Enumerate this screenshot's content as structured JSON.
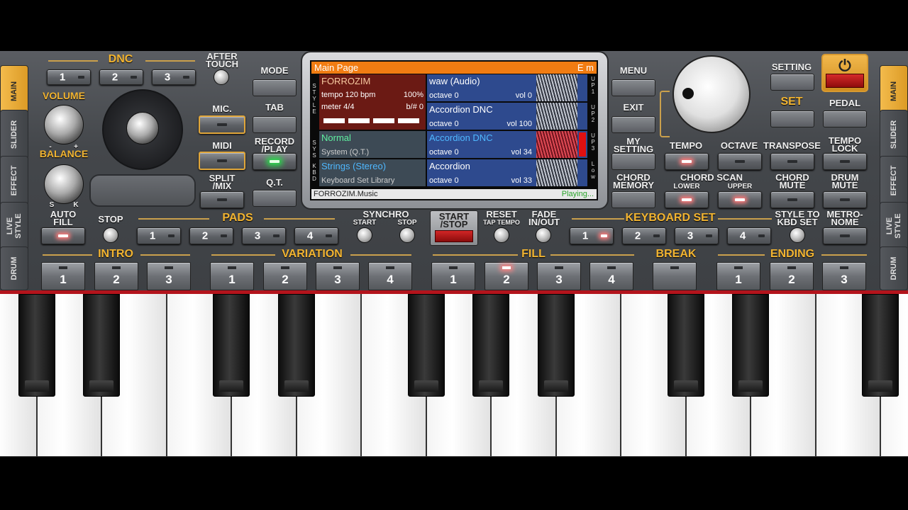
{
  "left_tabs": [
    "MAIN",
    "SLIDER",
    "EFFECT",
    "LIVE\nSTYLE",
    "DRUM"
  ],
  "right_tabs": [
    "MAIN",
    "SLIDER",
    "EFFECT",
    "LIVE\nSTYLE",
    "DRUM"
  ],
  "dnc": {
    "title": "DNC",
    "buttons": [
      "1",
      "2",
      "3"
    ]
  },
  "after_touch": "AFTER\nTOUCH",
  "volume": "VOLUME",
  "balance": "BALANCE",
  "balance_minus": "-",
  "balance_plus": "+",
  "balance_s": "S",
  "balance_k": "K",
  "mic": "MIC.",
  "midi": "MIDI",
  "split_mix": "SPLIT\n/MIX",
  "left_col": [
    "MODE",
    "TAB",
    "RECORD\n/PLAY",
    "Q.T."
  ],
  "right_col": [
    "MENU",
    "EXIT",
    "MY\nSETTING",
    "CHORD\nMEMORY"
  ],
  "setting": "SETTING",
  "set": "SET",
  "pedal": "PEDAL",
  "row_top": {
    "tempo": "TEMPO",
    "octave": "OCTAVE",
    "transpose": "TRANSPOSE",
    "tempo_lock": "TEMPO\nLOCK"
  },
  "chord_scan": "CHORD SCAN",
  "lower": "LOWER",
  "upper": "UPPER",
  "chord_mute": "CHORD\nMUTE",
  "drum_mute": "DRUM\nMUTE",
  "display": {
    "page": "Main Page",
    "key": "E m",
    "style_name": "FORROZIM",
    "tempo": "tempo 120 bpm",
    "percent": "100%",
    "meter": "meter 4/4",
    "transpose": "b/# 0",
    "sys_name": "Normal",
    "sys_sub": "System (Q.T.)",
    "kbd_name": "Strings (Stereo)",
    "kbd_sub": "Keyboard Set Library",
    "up1_name": "waw (Audio)",
    "up1_oct": "octave  0",
    "up1_vol": "vol 0",
    "up2_name": "Accordion DNC",
    "up2_oct": "octave  0",
    "up2_vol": "vol 100",
    "up3_name": "Accordion DNC",
    "up3_oct": "octave  0",
    "up3_vol": "vol 34",
    "low_name": "Accordion",
    "low_oct": "octave  0",
    "low_vol": "vol 33",
    "footer": "FORROZIM.Music",
    "status": "Playing...",
    "side_style": "S\nT\nY\nL\nE",
    "side_sys": "S\nY\nS",
    "side_kbd": "K\nB\nD",
    "side_up1": "U\nP\n1",
    "side_up2": "U\nP\n2",
    "side_up3": "U\nP\n3",
    "side_low": "L\no\nw"
  },
  "row2": {
    "auto_fill": "AUTO\nFILL",
    "stop": "STOP",
    "pads": "PADS",
    "pad_buttons": [
      "1",
      "2",
      "3",
      "4"
    ],
    "synchro": "SYNCHRO",
    "sync_start": "START",
    "sync_stop": "STOP",
    "start_stop": "START\n/STOP",
    "reset": "RESET",
    "tap_tempo": "TAP TEMPO",
    "fade": "FADE\nIN/OUT",
    "keyboard_set": "KEYBOARD SET",
    "kbd_buttons": [
      "1",
      "2",
      "3",
      "4"
    ],
    "style_to_kbd": "STYLE TO\nKBD SET",
    "metronome": "METRO-\nNOME"
  },
  "bottom": {
    "intro": "INTRO",
    "intro_pads": [
      "1",
      "2",
      "3"
    ],
    "variation": "VARIATION",
    "variation_pads": [
      "1",
      "2",
      "3",
      "4"
    ],
    "fill": "FILL",
    "fill_pads": [
      "1",
      "2",
      "3",
      "4"
    ],
    "break": "BREAK",
    "ending": "ENDING",
    "ending_pads": [
      "1",
      "2",
      "3"
    ]
  },
  "colors": {
    "accent": "#f2b431",
    "lcd_header": "#f17c12",
    "style_bg": "#6b1a14",
    "track_bg": "#2e4a8e",
    "active_led": "#ff7a7a"
  }
}
